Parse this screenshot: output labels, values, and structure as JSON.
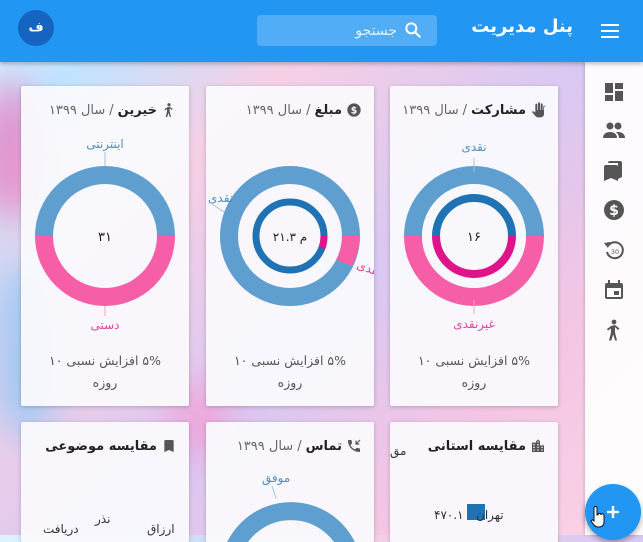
{
  "header": {
    "title": "پنل مدیریت",
    "search_placeholder": "جستجو",
    "avatar_initial": "ف"
  },
  "sidebar": {
    "items": [
      {
        "icon": "dashboard-icon"
      },
      {
        "icon": "people-icon"
      },
      {
        "icon": "bookmarks-icon"
      },
      {
        "icon": "dollar-icon"
      },
      {
        "icon": "replay-30-icon"
      },
      {
        "icon": "calendar-icon"
      },
      {
        "icon": "person-icon"
      }
    ]
  },
  "cards": {
    "participation": {
      "title": "مشارکت",
      "sub": "سال ۱۳۹۹",
      "center": "۱۶",
      "label_top": "نقدی",
      "label_bottom": "غیرنقدی",
      "foot_1": "۵% افزایش نسبی ۱۰",
      "foot_2": "روزه"
    },
    "amount": {
      "title": "مبلغ",
      "sub": "سال ۱۳۹۹",
      "center": "۲۱.۳ م",
      "label_left": "نقدی",
      "label_right": "غیرنقدی",
      "foot_1": "۵% افزایش نسبی ۱۰",
      "foot_2": "روزه"
    },
    "donors": {
      "title": "خیرین",
      "sub": "سال ۱۳۹۹",
      "center": "۳۱",
      "label_top": "اینترنتی",
      "label_bottom": "دستی",
      "foot_1": "۵% افزایش نسبی ۱۰",
      "foot_2": "روزه"
    },
    "province": {
      "title": "مقایسه استانی",
      "partial_label": "مق",
      "bar_label": "تهران",
      "bar_value": "۴۷۰.۱"
    },
    "contact": {
      "title": "تماس",
      "sub": "سال ۱۳۹۹",
      "label_top": "موفق"
    },
    "topic": {
      "title": "مقایسه موضوعی",
      "labels": [
        "نذر",
        "دریافت",
        "ارزاق"
      ]
    }
  },
  "colors": {
    "primary": "#2196f3",
    "blue": "#5f9fcf",
    "dark_blue": "#1f72b4",
    "pink": "#f65ea8",
    "magenta": "#e0148a"
  }
}
